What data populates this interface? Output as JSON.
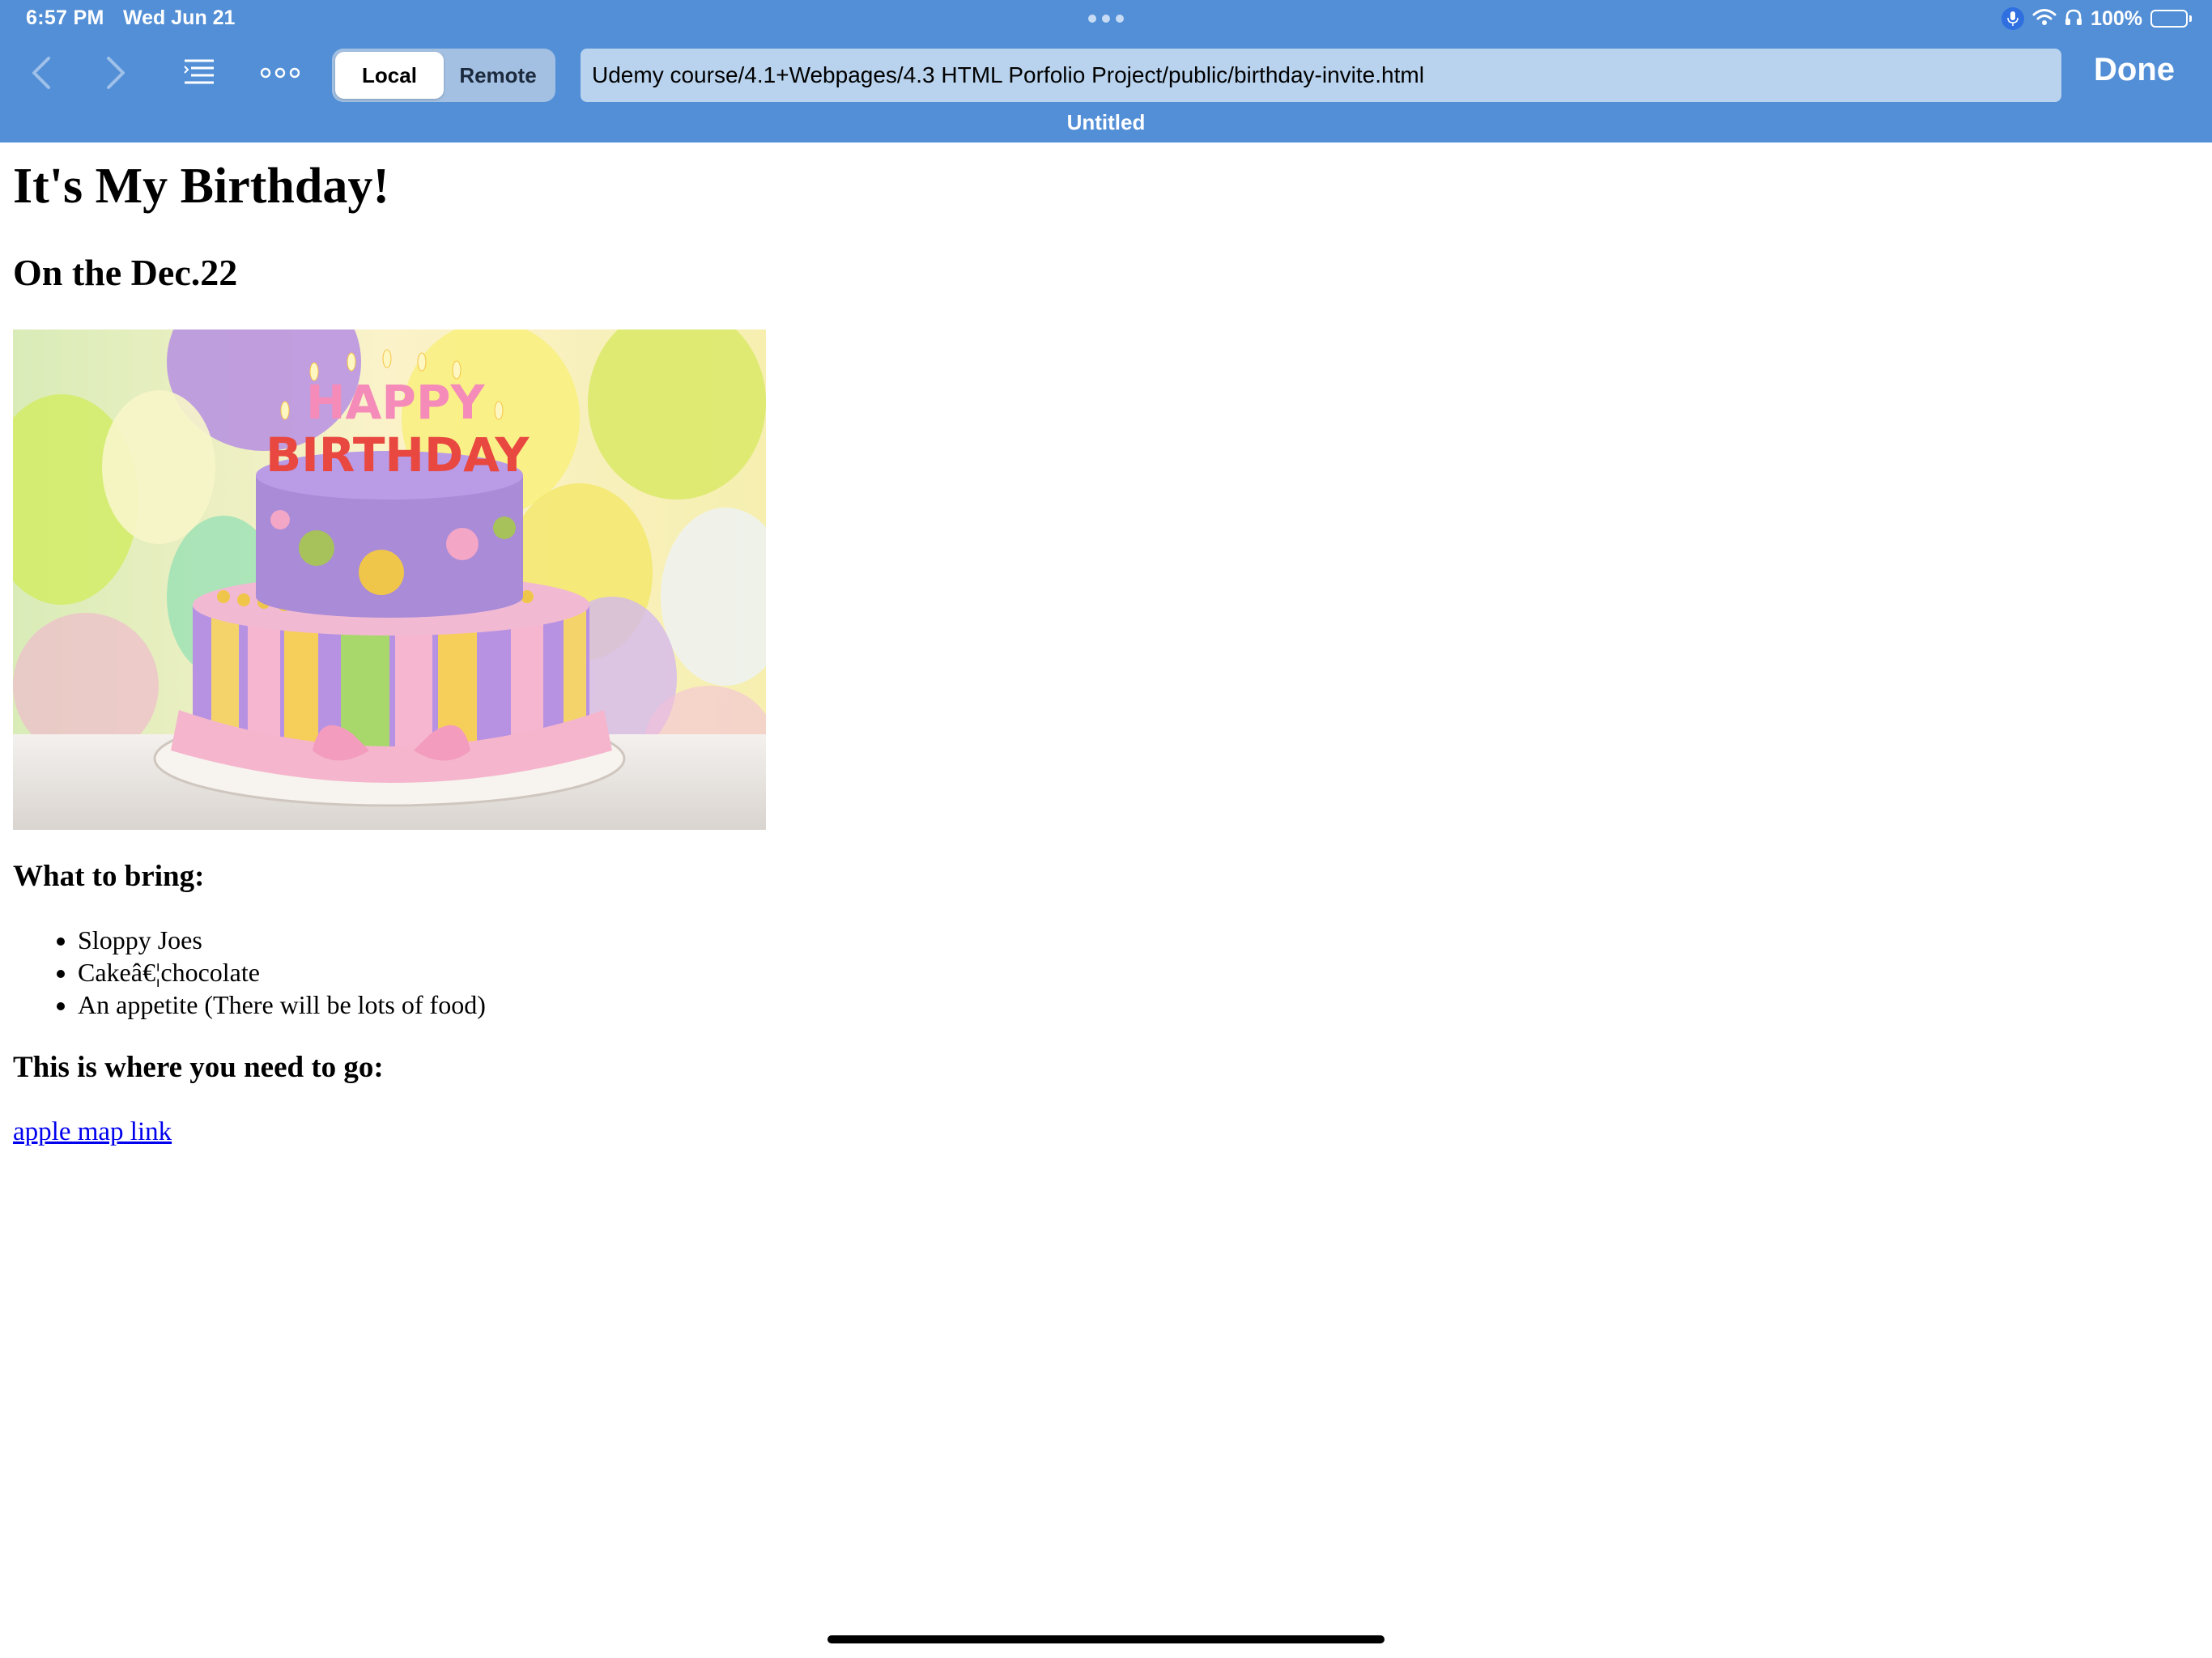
{
  "status_bar": {
    "time": "6:57 PM",
    "date": "Wed Jun 21",
    "battery": "100%"
  },
  "toolbar": {
    "segments": [
      "Local",
      "Remote"
    ],
    "selected_segment": "Local",
    "url": "Udemy course/4.1+Webpages/4.3 HTML Porfolio Project/public/birthday-invite.html",
    "done_label": "Done",
    "document_title": "Untitled"
  },
  "page": {
    "title": "It's My Birthday!",
    "subtitle": "On the Dec.22",
    "image": {
      "banner_text_top": "HAPPY",
      "banner_text_bottom": "BIRTHDAY"
    },
    "bring_heading": "What to bring:",
    "bring_items": [
      "Sloppy Joes",
      "Cakeâ€¦chocolate",
      "An appetite (There will be lots of food)"
    ],
    "where_heading": "This is where you need to go:",
    "map_link": "apple map link"
  },
  "colors": {
    "toolbar_bg": "#528fd6",
    "url_bar_bg": "#b9d3ee",
    "link": "#0000ee"
  }
}
